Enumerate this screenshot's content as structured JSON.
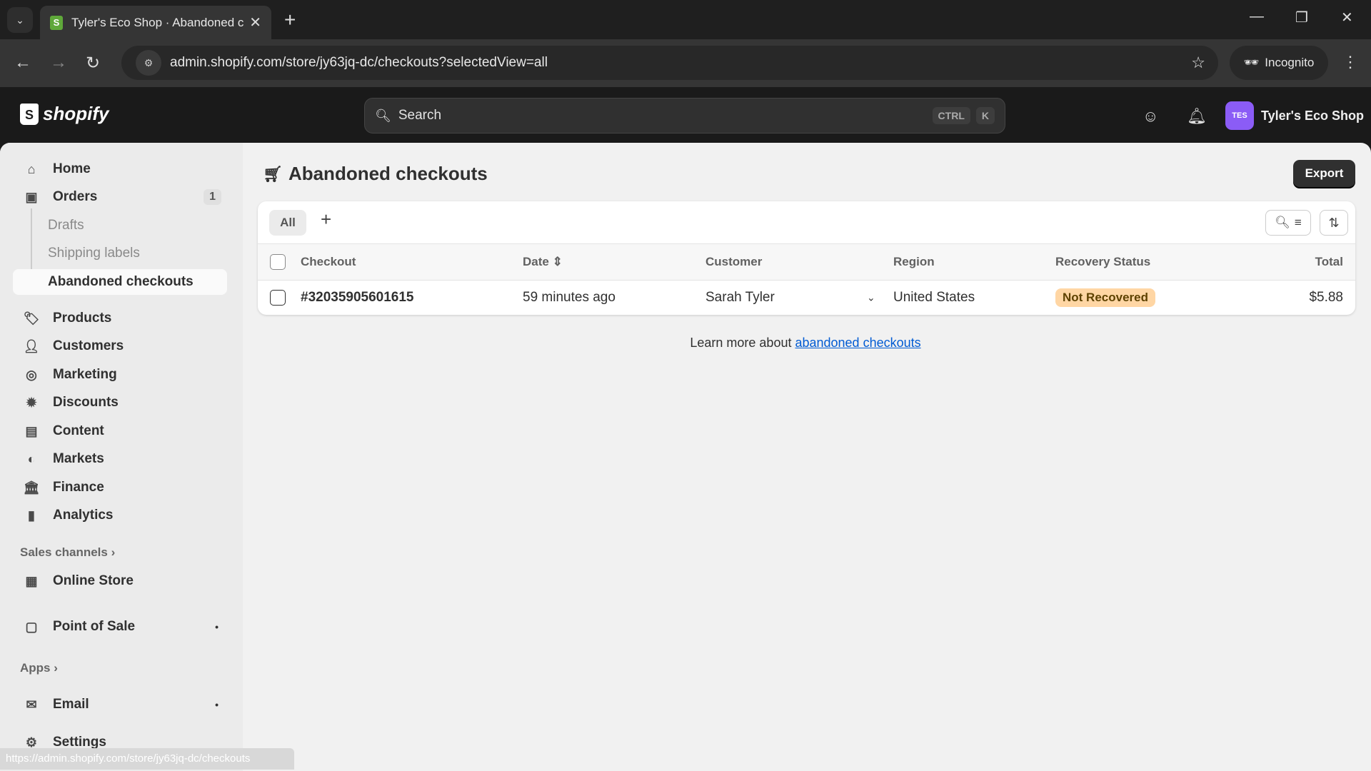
{
  "browser": {
    "tab_title": "Tyler's Eco Shop · Abandoned c",
    "url": "admin.shopify.com/store/jy63jq-dc/checkouts?selectedView=all",
    "incognito_label": "Incognito",
    "status_url": "https://admin.shopify.com/store/jy63jq-dc/checkouts"
  },
  "header": {
    "logo": "shopify",
    "search_placeholder": "Search",
    "kbd1": "CTRL",
    "kbd2": "K",
    "store_initials": "TES",
    "store_name": "Tyler's Eco Shop"
  },
  "sidebar": {
    "home": "Home",
    "orders": "Orders",
    "orders_badge": "1",
    "drafts": "Drafts",
    "shipping": "Shipping labels",
    "abandoned": "Abandoned checkouts",
    "products": "Products",
    "customers": "Customers",
    "marketing": "Marketing",
    "discounts": "Discounts",
    "content": "Content",
    "markets": "Markets",
    "finance": "Finance",
    "analytics": "Analytics",
    "sales_channels": "Sales channels",
    "online_store": "Online Store",
    "pos": "Point of Sale",
    "apps": "Apps",
    "email": "Email",
    "settings": "Settings"
  },
  "page": {
    "title": "Abandoned checkouts",
    "export": "Export",
    "tab_all": "All",
    "columns": {
      "checkout": "Checkout",
      "date": "Date",
      "customer": "Customer",
      "region": "Region",
      "recovery": "Recovery Status",
      "total": "Total"
    },
    "rows": [
      {
        "checkout": "#32035905601615",
        "date": "59 minutes ago",
        "customer": "Sarah Tyler",
        "region": "United States",
        "status": "Not Recovered",
        "total": "$5.88"
      }
    ],
    "learn_prefix": "Learn more about ",
    "learn_link": "abandoned checkouts"
  }
}
